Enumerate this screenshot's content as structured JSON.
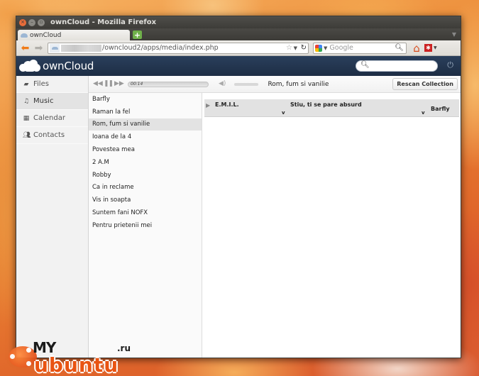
{
  "window": {
    "title": "ownCloud - Mozilla Firefox"
  },
  "browser": {
    "tab_title": "ownCloud",
    "new_tab_symbol": "+",
    "url_path": "/owncloud2/apps/media/index.php",
    "search_placeholder": "Google"
  },
  "owncloud": {
    "logo_text": "ownCloud",
    "search_value": "",
    "nav": [
      {
        "label": "Files",
        "icon": "folder-icon"
      },
      {
        "label": "Music",
        "icon": "music-note-icon"
      },
      {
        "label": "Calendar",
        "icon": "calendar-icon"
      },
      {
        "label": "Contacts",
        "icon": "contacts-icon"
      }
    ],
    "active_nav": "Music"
  },
  "player": {
    "elapsed": "00:14",
    "now_playing": "Rom, fum si vanilie",
    "rescan_label": "Rescan Collection"
  },
  "playlist": {
    "songs": [
      "Barfly",
      "Raman la fel",
      "Rom, fum si vanilie",
      "Ioana de la 4",
      "Povestea mea",
      "2 A.M",
      "Robby",
      "Ca in reclame",
      "Vis in soapta",
      "Suntem fani NOFX",
      "Pentru prietenii mei"
    ],
    "active_song": "Rom, fum si vanilie"
  },
  "collection": {
    "artist": "E.M.I.L.",
    "album": "Stiu, ti se pare absurd",
    "song": "Barfly",
    "album_toggle": "v",
    "song_toggle": "v"
  },
  "watermark": {
    "my": "MY",
    "ru": ".ru",
    "ubuntu": "ubuntu"
  },
  "colors": {
    "oc_header": "#1d2d44",
    "firefox_orange": "#f07b18",
    "ubuntu_orange": "#e95412"
  }
}
